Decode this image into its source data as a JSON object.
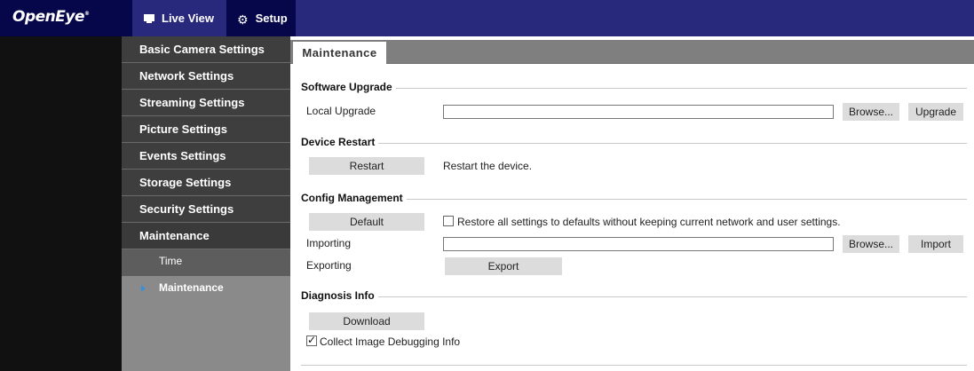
{
  "header": {
    "logo": "OpenEye",
    "logo_mark": "®",
    "nav": [
      {
        "label": "Live View",
        "icon": "monitor-icon"
      },
      {
        "label": "Setup",
        "icon": "gear-icon"
      }
    ]
  },
  "sidebar": {
    "items": [
      {
        "label": "Basic Camera Settings"
      },
      {
        "label": "Network Settings"
      },
      {
        "label": "Streaming Settings"
      },
      {
        "label": "Picture Settings"
      },
      {
        "label": "Events Settings"
      },
      {
        "label": "Storage Settings"
      },
      {
        "label": "Security Settings"
      },
      {
        "label": "Maintenance"
      }
    ],
    "subitems": [
      {
        "label": "Time"
      },
      {
        "label": "Maintenance"
      }
    ]
  },
  "tab": {
    "label": "Maintenance"
  },
  "software_upgrade": {
    "title": "Software Upgrade",
    "local_upgrade_label": "Local Upgrade",
    "file_value": "",
    "browse_label": "Browse...",
    "upgrade_label": "Upgrade"
  },
  "device_restart": {
    "title": "Device Restart",
    "restart_label": "Restart",
    "description": "Restart the device."
  },
  "config_management": {
    "title": "Config Management",
    "default_label": "Default",
    "restore_checkbox_label": "Restore all settings to defaults without keeping current network and user settings.",
    "restore_checked": false,
    "importing_label": "Importing",
    "import_file_value": "",
    "browse_label": "Browse...",
    "import_label": "Import",
    "exporting_label": "Exporting",
    "export_label": "Export"
  },
  "diagnosis_info": {
    "title": "Diagnosis Info",
    "download_label": "Download",
    "collect_checkbox_label": "Collect Image Debugging Info",
    "collect_checked": true
  },
  "colors": {
    "header_bg": "#28287c",
    "header_dark": "#06064a",
    "sidebar_dark": "#3e3e3e",
    "sidebar_light": "#8a8a8a",
    "accent_arrow": "#3b8fd8"
  }
}
